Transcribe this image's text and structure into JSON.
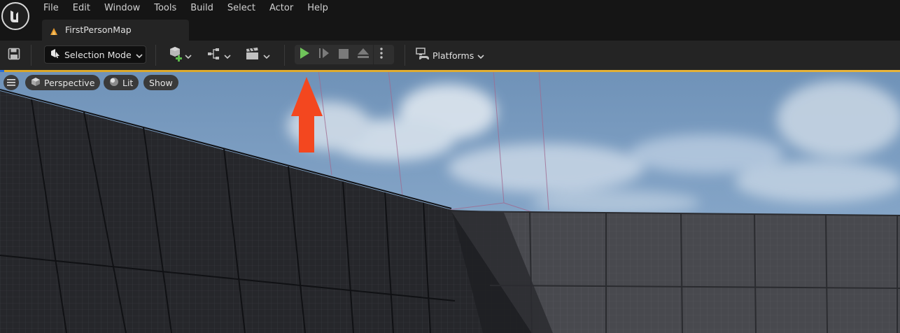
{
  "menubar": {
    "items": [
      "File",
      "Edit",
      "Window",
      "Tools",
      "Build",
      "Select",
      "Actor",
      "Help"
    ]
  },
  "document_tab": {
    "title": "FirstPersonMap"
  },
  "toolbar": {
    "selection_mode_label": "Selection Mode",
    "platforms_label": "Platforms",
    "play_color": "#6fc35a"
  },
  "viewport": {
    "perspective_label": "Perspective",
    "lit_label": "Lit",
    "show_label": "Show",
    "annotation_arrow_color": "#f3471f"
  }
}
